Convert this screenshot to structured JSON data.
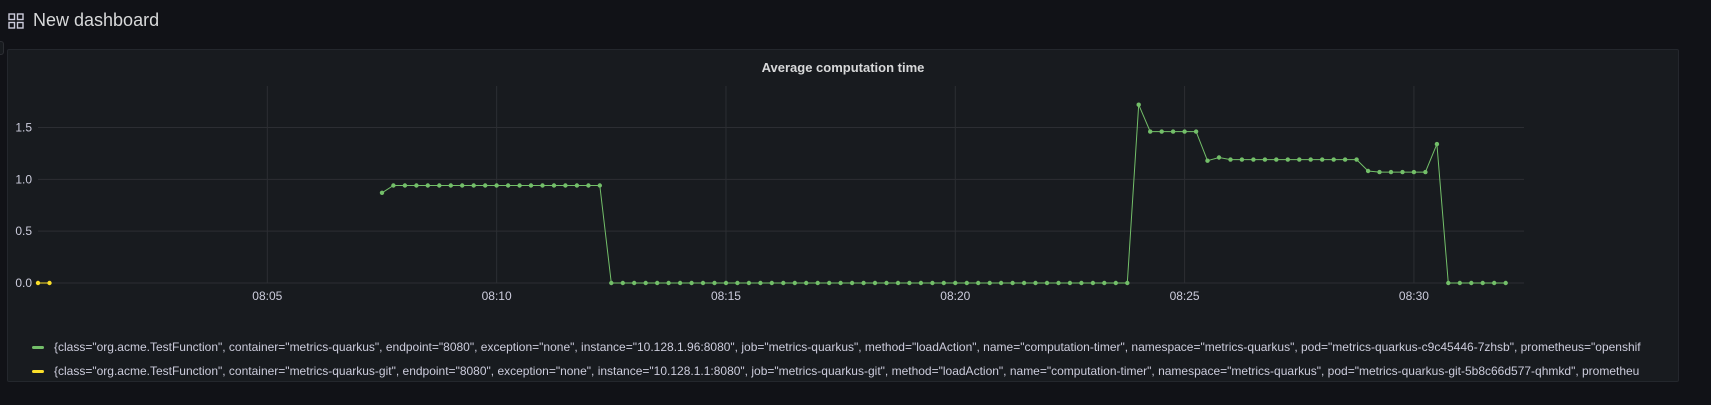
{
  "dashboard": {
    "title": "New dashboard",
    "icon": "dashboard-grid-icon"
  },
  "panel": {
    "title": "Average computation time"
  },
  "colors": {
    "background": "#111217",
    "panel": "#181b1f",
    "grid": "#2c2e33",
    "series_green": "#73bf69",
    "series_yellow": "#fade2a"
  },
  "chart_data": {
    "type": "line",
    "title": "Average computation time",
    "xlabel": "",
    "ylabel": "",
    "x_ticks": [
      "08:05",
      "08:10",
      "08:15",
      "08:20",
      "08:25",
      "08:30"
    ],
    "x_tick_minutes": [
      305,
      310,
      315,
      320,
      325,
      330
    ],
    "xlim_minutes": [
      300.0,
      332.4
    ],
    "y_ticks": [
      0.0,
      0.5,
      1.0,
      1.5
    ],
    "y_tick_labels": [
      "0.0",
      "0.5",
      "1.0",
      "1.5"
    ],
    "ylim": [
      0,
      1.9
    ],
    "grid": true,
    "legend_position": "bottom",
    "series": [
      {
        "name": "{class=\"org.acme.TestFunction\", container=\"metrics-quarkus\", endpoint=\"8080\", exception=\"none\", instance=\"10.128.1.96:8080\", job=\"metrics-quarkus\", method=\"loadAction\", name=\"computation-timer\", namespace=\"metrics-quarkus\", pod=\"metrics-quarkus-c9c45446-7zhsb\", prometheus=\"openshif",
        "color": "#73bf69",
        "points": [
          [
            307.5,
            0.87
          ],
          [
            307.75,
            0.94
          ],
          [
            308.0,
            0.94
          ],
          [
            308.25,
            0.94
          ],
          [
            308.5,
            0.94
          ],
          [
            308.75,
            0.94
          ],
          [
            309.0,
            0.94
          ],
          [
            309.25,
            0.94
          ],
          [
            309.5,
            0.94
          ],
          [
            309.75,
            0.94
          ],
          [
            310.0,
            0.94
          ],
          [
            310.25,
            0.94
          ],
          [
            310.5,
            0.94
          ],
          [
            310.75,
            0.94
          ],
          [
            311.0,
            0.94
          ],
          [
            311.25,
            0.94
          ],
          [
            311.5,
            0.94
          ],
          [
            311.75,
            0.94
          ],
          [
            312.0,
            0.94
          ],
          [
            312.25,
            0.94
          ],
          [
            312.5,
            0.0
          ],
          [
            312.75,
            0.0
          ],
          [
            313.0,
            0.0
          ],
          [
            313.25,
            0.0
          ],
          [
            313.5,
            0.0
          ],
          [
            313.75,
            0.0
          ],
          [
            314.0,
            0.0
          ],
          [
            314.25,
            0.0
          ],
          [
            314.5,
            0.0
          ],
          [
            314.75,
            0.0
          ],
          [
            315.0,
            0.0
          ],
          [
            315.25,
            0.0
          ],
          [
            315.5,
            0.0
          ],
          [
            315.75,
            0.0
          ],
          [
            316.0,
            0.0
          ],
          [
            316.25,
            0.0
          ],
          [
            316.5,
            0.0
          ],
          [
            316.75,
            0.0
          ],
          [
            317.0,
            0.0
          ],
          [
            317.25,
            0.0
          ],
          [
            317.5,
            0.0
          ],
          [
            317.75,
            0.0
          ],
          [
            318.0,
            0.0
          ],
          [
            318.25,
            0.0
          ],
          [
            318.5,
            0.0
          ],
          [
            318.75,
            0.0
          ],
          [
            319.0,
            0.0
          ],
          [
            319.25,
            0.0
          ],
          [
            319.5,
            0.0
          ],
          [
            319.75,
            0.0
          ],
          [
            320.0,
            0.0
          ],
          [
            320.25,
            0.0
          ],
          [
            320.5,
            0.0
          ],
          [
            320.75,
            0.0
          ],
          [
            321.0,
            0.0
          ],
          [
            321.25,
            0.0
          ],
          [
            321.5,
            0.0
          ],
          [
            321.75,
            0.0
          ],
          [
            322.0,
            0.0
          ],
          [
            322.25,
            0.0
          ],
          [
            322.5,
            0.0
          ],
          [
            322.75,
            0.0
          ],
          [
            323.0,
            0.0
          ],
          [
            323.25,
            0.0
          ],
          [
            323.5,
            0.0
          ],
          [
            323.75,
            0.0
          ],
          [
            324.0,
            1.72
          ],
          [
            324.25,
            1.46
          ],
          [
            324.5,
            1.46
          ],
          [
            324.75,
            1.46
          ],
          [
            325.0,
            1.46
          ],
          [
            325.25,
            1.46
          ],
          [
            325.5,
            1.18
          ],
          [
            325.75,
            1.21
          ],
          [
            326.0,
            1.19
          ],
          [
            326.25,
            1.19
          ],
          [
            326.5,
            1.19
          ],
          [
            326.75,
            1.19
          ],
          [
            327.0,
            1.19
          ],
          [
            327.25,
            1.19
          ],
          [
            327.5,
            1.19
          ],
          [
            327.75,
            1.19
          ],
          [
            328.0,
            1.19
          ],
          [
            328.25,
            1.19
          ],
          [
            328.5,
            1.19
          ],
          [
            328.75,
            1.19
          ],
          [
            329.0,
            1.08
          ],
          [
            329.25,
            1.07
          ],
          [
            329.5,
            1.07
          ],
          [
            329.75,
            1.07
          ],
          [
            330.0,
            1.07
          ],
          [
            330.25,
            1.07
          ],
          [
            330.5,
            1.34
          ],
          [
            330.75,
            0.0
          ],
          [
            331.0,
            0.0
          ],
          [
            331.25,
            0.0
          ],
          [
            331.5,
            0.0
          ],
          [
            331.75,
            0.0
          ],
          [
            332.0,
            0.0
          ]
        ]
      },
      {
        "name": "{class=\"org.acme.TestFunction\", container=\"metrics-quarkus-git\", endpoint=\"8080\", exception=\"none\", instance=\"10.128.1.1:8080\", job=\"metrics-quarkus-git\", method=\"loadAction\", name=\"computation-timer\", namespace=\"metrics-quarkus\", pod=\"metrics-quarkus-git-5b8c66d577-qhmkd\", prometheu",
        "color": "#fade2a",
        "points": [
          [
            300.0,
            0.0
          ],
          [
            300.25,
            0.0
          ]
        ]
      }
    ]
  }
}
